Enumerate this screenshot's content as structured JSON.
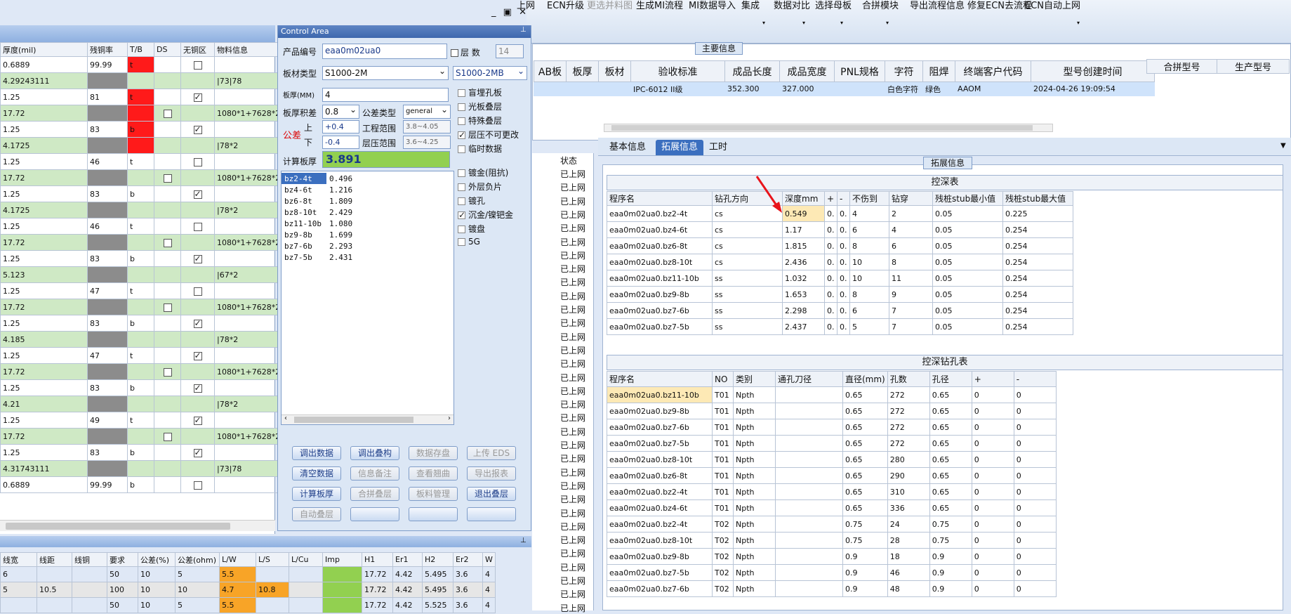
{
  "ribbon": {
    "items": [
      {
        "label": "上网",
        "dim": false
      },
      {
        "label": "ECN升级",
        "dim": false
      },
      {
        "label": "更选并料图",
        "dim": true
      },
      {
        "label": "生成MI流程",
        "dim": false
      },
      {
        "label": "MI数据导入",
        "dim": false
      },
      {
        "label": "集成",
        "dim": false
      },
      {
        "label": "数据对比",
        "dim": false
      },
      {
        "label": "选择母板",
        "dim": false
      },
      {
        "label": "合拼模块",
        "dim": false
      },
      {
        "label": "导出流程信息",
        "dim": false
      },
      {
        "label": "修复ECN去流程",
        "dim": false
      },
      {
        "label": "ECN自动上网",
        "dim": false
      }
    ]
  },
  "left_grid": {
    "headers": [
      "厚度(mil)",
      "残铜率",
      "T/B",
      "DS",
      "无铜区",
      "物料信息"
    ],
    "rows": [
      {
        "c": [
          "0.6889",
          "99.99",
          "t",
          "",
          "",
          ""
        ],
        "g": false,
        "tb": "rd",
        "res": "w",
        "ds": false,
        "nc": true,
        "nc_on": false
      },
      {
        "c": [
          "4.29243111",
          "",
          "",
          "",
          "",
          "|73|78"
        ],
        "g": true,
        "tb": "",
        "res": "gy",
        "ds": false,
        "nc": false,
        "nc_on": false
      },
      {
        "c": [
          "1.25",
          "81",
          "t",
          "",
          "",
          ""
        ],
        "g": false,
        "tb": "rd",
        "res": "w",
        "ds": false,
        "nc": true,
        "nc_on": true
      },
      {
        "c": [
          "17.72",
          "",
          "",
          "",
          "",
          "1080*1+7628*2"
        ],
        "g": true,
        "tb": "rd",
        "res": "gy",
        "ds": true,
        "nc": false,
        "nc_on": false
      },
      {
        "c": [
          "1.25",
          "83",
          "b",
          "",
          "",
          ""
        ],
        "g": false,
        "tb": "rd",
        "res": "w",
        "ds": false,
        "nc": true,
        "nc_on": true
      },
      {
        "c": [
          "4.1725",
          "",
          "",
          "",
          "",
          "|78*2"
        ],
        "g": true,
        "tb": "rd",
        "res": "gy",
        "ds": false,
        "nc": false,
        "nc_on": false
      },
      {
        "c": [
          "1.25",
          "46",
          "t",
          "",
          "",
          ""
        ],
        "g": false,
        "tb": "",
        "res": "w",
        "ds": false,
        "nc": true,
        "nc_on": false
      },
      {
        "c": [
          "17.72",
          "",
          "",
          "",
          "",
          "1080*1+7628*2"
        ],
        "g": true,
        "tb": "",
        "res": "gy",
        "ds": true,
        "nc": false,
        "nc_on": false
      },
      {
        "c": [
          "1.25",
          "83",
          "b",
          "",
          "",
          ""
        ],
        "g": false,
        "tb": "",
        "res": "w",
        "ds": false,
        "nc": true,
        "nc_on": true
      },
      {
        "c": [
          "4.1725",
          "",
          "",
          "",
          "",
          "|78*2"
        ],
        "g": true,
        "tb": "",
        "res": "gy",
        "ds": false,
        "nc": false,
        "nc_on": false
      },
      {
        "c": [
          "1.25",
          "46",
          "t",
          "",
          "",
          ""
        ],
        "g": false,
        "tb": "",
        "res": "w",
        "ds": false,
        "nc": true,
        "nc_on": false
      },
      {
        "c": [
          "17.72",
          "",
          "",
          "",
          "",
          "1080*1+7628*2"
        ],
        "g": true,
        "tb": "",
        "res": "gy",
        "ds": true,
        "nc": false,
        "nc_on": false
      },
      {
        "c": [
          "1.25",
          "83",
          "b",
          "",
          "",
          ""
        ],
        "g": false,
        "tb": "",
        "res": "w",
        "ds": false,
        "nc": true,
        "nc_on": true
      },
      {
        "c": [
          "5.123",
          "",
          "",
          "",
          "",
          "|67*2"
        ],
        "g": true,
        "tb": "",
        "res": "gy",
        "ds": false,
        "nc": false,
        "nc_on": false
      },
      {
        "c": [
          "1.25",
          "47",
          "t",
          "",
          "",
          ""
        ],
        "g": false,
        "tb": "",
        "res": "w",
        "ds": false,
        "nc": true,
        "nc_on": false
      },
      {
        "c": [
          "17.72",
          "",
          "",
          "",
          "",
          "1080*1+7628*2"
        ],
        "g": true,
        "tb": "",
        "res": "gy",
        "ds": true,
        "nc": false,
        "nc_on": false
      },
      {
        "c": [
          "1.25",
          "83",
          "b",
          "",
          "",
          ""
        ],
        "g": false,
        "tb": "",
        "res": "w",
        "ds": false,
        "nc": true,
        "nc_on": true
      },
      {
        "c": [
          "4.185",
          "",
          "",
          "",
          "",
          "|78*2"
        ],
        "g": true,
        "tb": "",
        "res": "gy",
        "ds": false,
        "nc": false,
        "nc_on": false
      },
      {
        "c": [
          "1.25",
          "47",
          "t",
          "",
          "",
          ""
        ],
        "g": false,
        "tb": "",
        "res": "w",
        "ds": false,
        "nc": true,
        "nc_on": true
      },
      {
        "c": [
          "17.72",
          "",
          "",
          "",
          "",
          "1080*1+7628*2"
        ],
        "g": true,
        "tb": "",
        "res": "gy",
        "ds": true,
        "nc": false,
        "nc_on": false
      },
      {
        "c": [
          "1.25",
          "83",
          "b",
          "",
          "",
          ""
        ],
        "g": false,
        "tb": "",
        "res": "w",
        "ds": false,
        "nc": true,
        "nc_on": true
      },
      {
        "c": [
          "4.21",
          "",
          "",
          "",
          "",
          "|78*2"
        ],
        "g": true,
        "tb": "",
        "res": "gy",
        "ds": false,
        "nc": false,
        "nc_on": false
      },
      {
        "c": [
          "1.25",
          "49",
          "t",
          "",
          "",
          ""
        ],
        "g": false,
        "tb": "",
        "res": "w",
        "ds": false,
        "nc": true,
        "nc_on": true
      },
      {
        "c": [
          "17.72",
          "",
          "",
          "",
          "",
          "1080*1+7628*2"
        ],
        "g": true,
        "tb": "",
        "res": "gy",
        "ds": true,
        "nc": false,
        "nc_on": false
      },
      {
        "c": [
          "1.25",
          "83",
          "b",
          "",
          "",
          ""
        ],
        "g": false,
        "tb": "",
        "res": "w",
        "ds": false,
        "nc": true,
        "nc_on": true
      },
      {
        "c": [
          "4.31743111",
          "",
          "",
          "",
          "",
          "|73|78"
        ],
        "g": true,
        "tb": "",
        "res": "gy",
        "ds": false,
        "nc": false,
        "nc_on": false
      },
      {
        "c": [
          "0.6889",
          "99.99",
          "b",
          "",
          "",
          ""
        ],
        "g": false,
        "tb": "",
        "res": "w",
        "ds": false,
        "nc": true,
        "nc_on": false
      }
    ]
  },
  "control": {
    "title": "Control Area",
    "product_label": "产品编号",
    "product_value": "eaa0m02ua0",
    "layer_label": "层 数",
    "layer_value": "14",
    "material_label": "板材类型",
    "material_value": "S1000-2M",
    "material_value2": "S1000-2MB",
    "thickness_label": "板厚(MM)",
    "thickness_value": "4",
    "tol_label": "板厚积差",
    "tol_value": "0.8",
    "tol_type_label": "公差类型",
    "tol_type_value": "general",
    "gc_label": "公差",
    "upper_label": "上",
    "lower_label": "下",
    "upper_value": "+0.4",
    "lower_value": "-0.4",
    "eng_range_label": "工程范围",
    "eng_range_value": "3.8~4.05",
    "press_range_label": "层压范围",
    "press_range_value": "3.6~4.25",
    "calc_label": "计算板厚",
    "calc_value": "3.891",
    "layers": [
      [
        "bz2-4t",
        "0.496"
      ],
      [
        "bz4-6t",
        "1.216"
      ],
      [
        "bz6-8t",
        "1.809"
      ],
      [
        "bz8-10t",
        "2.429"
      ],
      [
        "bz11-10b",
        "1.080"
      ],
      [
        "bz9-8b",
        "1.699"
      ],
      [
        "bz7-6b",
        "2.293"
      ],
      [
        "bz7-5b",
        "2.431"
      ]
    ],
    "options": [
      {
        "label": "盲埋孔板",
        "on": false
      },
      {
        "label": "光板叠层",
        "on": false
      },
      {
        "label": "特殊叠层",
        "on": false
      },
      {
        "label": "层压不可更改",
        "on": true
      },
      {
        "label": "临时数据",
        "on": false
      },
      {
        "label": "镀金(阻抗)",
        "on": false
      },
      {
        "label": "外层负片",
        "on": false
      },
      {
        "label": "镀孔",
        "on": false
      },
      {
        "label": "沉金/镍钯金",
        "on": true
      },
      {
        "label": "镀盘",
        "on": false
      },
      {
        "label": "5G",
        "on": false
      }
    ],
    "buttons": [
      {
        "label": "调出数据",
        "dis": false
      },
      {
        "label": "调出叠构",
        "dis": false
      },
      {
        "label": "数据存盘",
        "dis": true
      },
      {
        "label": "上传 EDS",
        "dis": true
      },
      {
        "label": "清空数据",
        "dis": false
      },
      {
        "label": "信息备注",
        "dis": true
      },
      {
        "label": "查看翘曲",
        "dis": true
      },
      {
        "label": "导出报表",
        "dis": true
      },
      {
        "label": "计算板厚",
        "dis": false
      },
      {
        "label": "合拼叠层",
        "dis": true
      },
      {
        "label": "板料管理",
        "dis": true
      },
      {
        "label": "退出叠层",
        "dis": false
      },
      {
        "label": "自动叠层",
        "dis": true
      },
      {
        "label": "",
        "dis": false
      },
      {
        "label": "",
        "dis": false
      },
      {
        "label": "",
        "dis": false
      }
    ]
  },
  "bottom_grid": {
    "headers": [
      "线宽",
      "线距",
      "线铜",
      "要求",
      "公差(%)",
      "公差(ohm)",
      "L/W",
      "L/S",
      "L/Cu",
      "Imp",
      "H1",
      "Er1",
      "H2",
      "Er2",
      "W"
    ],
    "rows": [
      [
        "6",
        "",
        "",
        "50",
        "10",
        "5",
        "5.5",
        "",
        "",
        "",
        "17.72",
        "4.42",
        "5.495",
        "3.6",
        "4"
      ],
      [
        "5",
        "10.5",
        "",
        "100",
        "10",
        "10",
        "4.7",
        "10.8",
        "",
        "",
        "17.72",
        "4.42",
        "5.495",
        "3.6",
        "4"
      ],
      [
        "",
        "",
        "",
        "50",
        "10",
        "5",
        "5.5",
        "",
        "",
        "",
        "17.72",
        "4.42",
        "5.525",
        "3.6",
        "4"
      ]
    ]
  },
  "main_info": {
    "label": "主要信息",
    "headers": [
      "AB板",
      "板厚",
      "板材",
      "验收标准",
      "成品长度",
      "成品宽度",
      "PNL规格",
      "字符",
      "阻焊",
      "终端客户代码",
      "型号创建时间"
    ],
    "row": [
      "",
      "",
      "",
      "IPC-6012 II级",
      "352.300",
      "327.000",
      "",
      "白色字符",
      "绿色",
      "AAOM",
      "2024-04-26 19:09:54"
    ],
    "right_headers": [
      "合拼型号",
      "生产型号"
    ]
  },
  "mid": {
    "status_label": "状态",
    "status_values": [
      "已上网",
      "已上网",
      "已上网",
      "已上网",
      "已上网",
      "已上网",
      "已上网",
      "已上网",
      "已上网",
      "已上网",
      "已上网",
      "已上网",
      "已上网",
      "已上网",
      "已上网",
      "已上网",
      "已上网",
      "已上网",
      "已上网",
      "已上网",
      "已上网",
      "已上网",
      "已上网",
      "已上网",
      "已上网",
      "已上网",
      "已上网",
      "已上网",
      "已上网",
      "已上网",
      "已上网",
      "已上网",
      "已上网"
    ]
  },
  "tabs": [
    "基本信息",
    "拓展信息",
    "工时"
  ],
  "ext": {
    "label": "拓展信息",
    "t1_title": "控深表",
    "t1_headers": [
      "程序名",
      "钻孔方向",
      "深度mm",
      "+",
      "-",
      "不伤到",
      "钻穿",
      "残桩stub最小值",
      "残桩stub最大值"
    ],
    "t1_rows": [
      [
        "eaa0m02ua0.bz2-4t",
        "cs",
        "0.549",
        "0.",
        "0.",
        "4",
        "2",
        "0.05",
        "0.225"
      ],
      [
        "eaa0m02ua0.bz4-6t",
        "cs",
        "1.17",
        "0.",
        "0.",
        "6",
        "4",
        "0.05",
        "0.254"
      ],
      [
        "eaa0m02ua0.bz6-8t",
        "cs",
        "1.815",
        "0.",
        "0.",
        "8",
        "6",
        "0.05",
        "0.254"
      ],
      [
        "eaa0m02ua0.bz8-10t",
        "cs",
        "2.436",
        "0.",
        "0.",
        "10",
        "8",
        "0.05",
        "0.254"
      ],
      [
        "eaa0m02ua0.bz11-10b",
        "ss",
        "1.032",
        "0.",
        "0.",
        "10",
        "11",
        "0.05",
        "0.254"
      ],
      [
        "eaa0m02ua0.bz9-8b",
        "ss",
        "1.653",
        "0.",
        "0.",
        "8",
        "9",
        "0.05",
        "0.254"
      ],
      [
        "eaa0m02ua0.bz7-6b",
        "ss",
        "2.298",
        "0.",
        "0.",
        "6",
        "7",
        "0.05",
        "0.254"
      ],
      [
        "eaa0m02ua0.bz7-5b",
        "ss",
        "2.437",
        "0.",
        "0.",
        "5",
        "7",
        "0.05",
        "0.254"
      ]
    ],
    "t2_title": "控深钻孔表",
    "t2_headers": [
      "程序名",
      "NO",
      "类别",
      "通孔刀径",
      "直径(mm)",
      "孔数",
      "孔径",
      "+",
      "-"
    ],
    "t2_rows": [
      [
        "eaa0m02ua0.bz11-10b",
        "T01",
        "Npth",
        "",
        "0.65",
        "272",
        "0.65",
        "0",
        "0"
      ],
      [
        "eaa0m02ua0.bz9-8b",
        "T01",
        "Npth",
        "",
        "0.65",
        "272",
        "0.65",
        "0",
        "0"
      ],
      [
        "eaa0m02ua0.bz7-6b",
        "T01",
        "Npth",
        "",
        "0.65",
        "272",
        "0.65",
        "0",
        "0"
      ],
      [
        "eaa0m02ua0.bz7-5b",
        "T01",
        "Npth",
        "",
        "0.65",
        "272",
        "0.65",
        "0",
        "0"
      ],
      [
        "eaa0m02ua0.bz8-10t",
        "T01",
        "Npth",
        "",
        "0.65",
        "280",
        "0.65",
        "0",
        "0"
      ],
      [
        "eaa0m02ua0.bz6-8t",
        "T01",
        "Npth",
        "",
        "0.65",
        "290",
        "0.65",
        "0",
        "0"
      ],
      [
        "eaa0m02ua0.bz2-4t",
        "T01",
        "Npth",
        "",
        "0.65",
        "310",
        "0.65",
        "0",
        "0"
      ],
      [
        "eaa0m02ua0.bz4-6t",
        "T01",
        "Npth",
        "",
        "0.65",
        "336",
        "0.65",
        "0",
        "0"
      ],
      [
        "eaa0m02ua0.bz2-4t",
        "T02",
        "Npth",
        "",
        "0.75",
        "24",
        "0.75",
        "0",
        "0"
      ],
      [
        "eaa0m02ua0.bz8-10t",
        "T02",
        "Npth",
        "",
        "0.75",
        "28",
        "0.75",
        "0",
        "0"
      ],
      [
        "eaa0m02ua0.bz9-8b",
        "T02",
        "Npth",
        "",
        "0.9",
        "18",
        "0.9",
        "0",
        "0"
      ],
      [
        "eaa0m02ua0.bz7-5b",
        "T02",
        "Npth",
        "",
        "0.9",
        "46",
        "0.9",
        "0",
        "0"
      ],
      [
        "eaa0m02ua0.bz7-6b",
        "T02",
        "Npth",
        "",
        "0.9",
        "48",
        "0.9",
        "0",
        "0"
      ]
    ]
  }
}
